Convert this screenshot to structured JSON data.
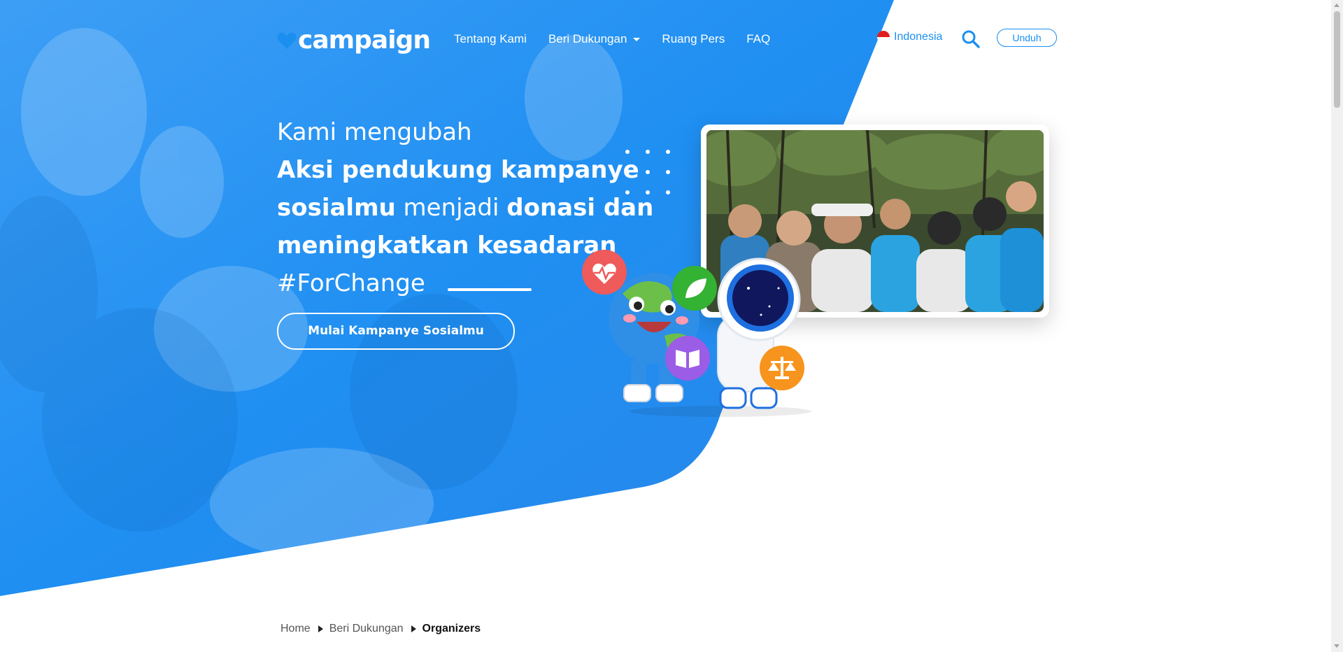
{
  "brand": {
    "name": "campaign"
  },
  "nav": {
    "items": [
      {
        "label": "Tentang Kami"
      },
      {
        "label": "Beri Dukungan"
      },
      {
        "label": "Ruang Pers"
      },
      {
        "label": "FAQ"
      }
    ],
    "language": "Indonesia",
    "download_label": "Unduh"
  },
  "hero": {
    "line1": "Kami mengubah",
    "part_bold_1": "Aksi pendukung kampanye sosialmu",
    "part_light_1": "menjadi",
    "part_bold_2": "donasi dan meningkatkan kesadaran",
    "hashtag": "#ForChange",
    "cta_label": "Mulai Kampanye Sosialmu"
  },
  "breadcrumb": {
    "items": [
      "Home",
      "Beri Dukungan"
    ],
    "current": "Organizers"
  },
  "colors": {
    "hero_blue": "#1f8ff2",
    "accent_blue": "#1a8ff0",
    "heart_badge": "#ef5a5a",
    "leaf_badge": "#34b233",
    "book_badge": "#9b5de5",
    "scale_badge": "#f7941d"
  },
  "icons": {
    "logo": "heart-icon",
    "search": "search-icon",
    "dropdown": "caret-down-icon",
    "language": "indonesia-flag-icon"
  }
}
